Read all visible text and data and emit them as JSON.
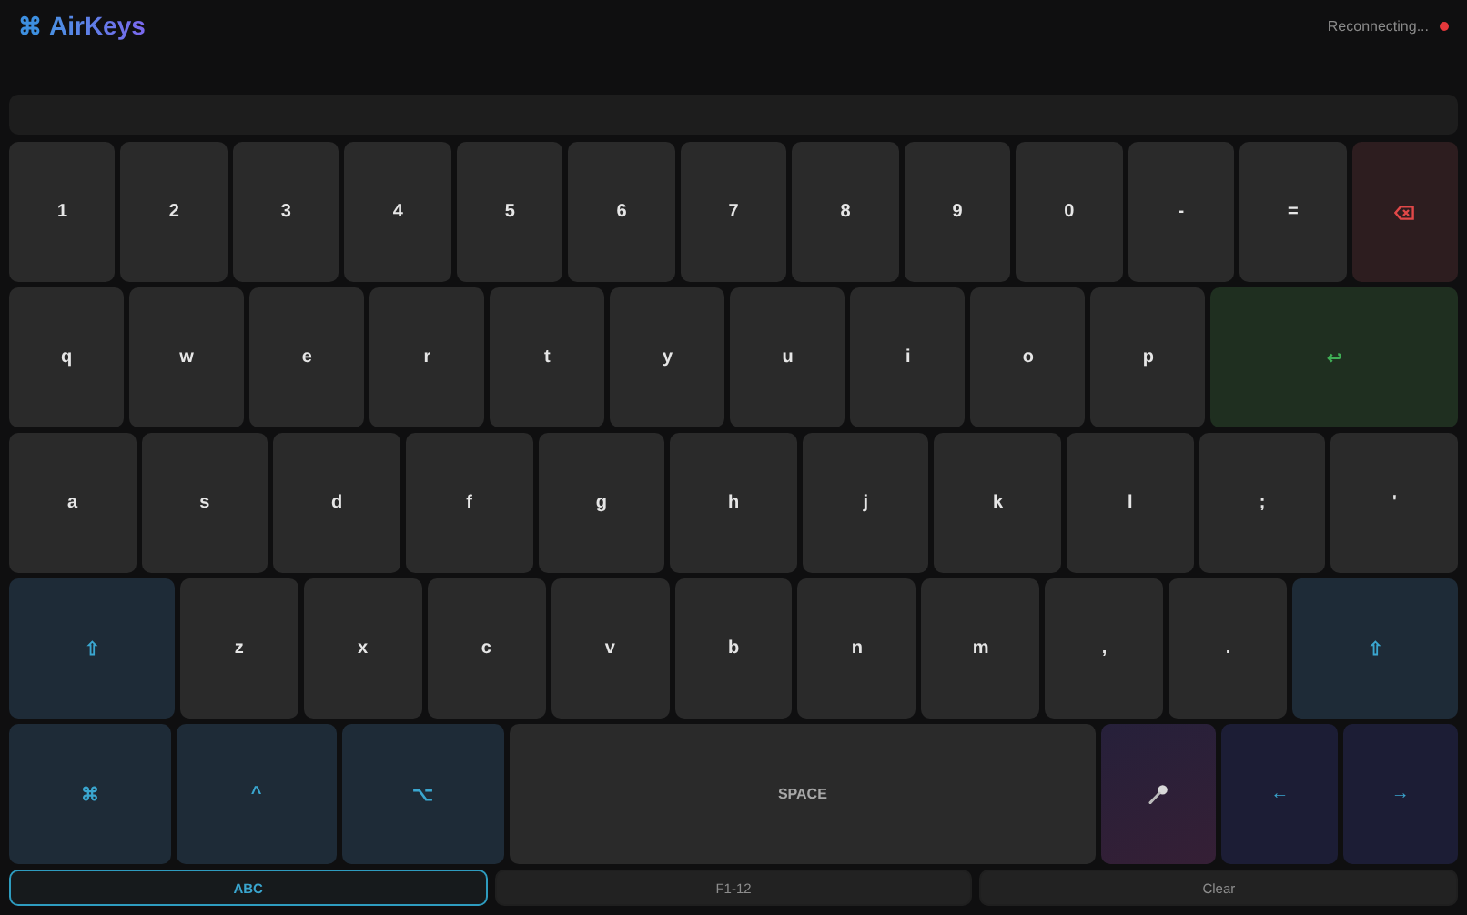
{
  "header": {
    "logo_icon": "⌘",
    "title": "AirKeys",
    "status": {
      "text": "Reconnecting...",
      "color": "#e5383b"
    }
  },
  "keyboard": {
    "rows": [
      [
        {
          "kind": "char",
          "label": "1"
        },
        {
          "kind": "char",
          "label": "2"
        },
        {
          "kind": "char",
          "label": "3"
        },
        {
          "kind": "char",
          "label": "4"
        },
        {
          "kind": "char",
          "label": "5"
        },
        {
          "kind": "char",
          "label": "6"
        },
        {
          "kind": "char",
          "label": "7"
        },
        {
          "kind": "char",
          "label": "8"
        },
        {
          "kind": "char",
          "label": "9"
        },
        {
          "kind": "char",
          "label": "0"
        },
        {
          "kind": "char",
          "label": "-"
        },
        {
          "kind": "char",
          "label": "="
        },
        {
          "kind": "backspace"
        }
      ],
      [
        {
          "kind": "char",
          "label": "q"
        },
        {
          "kind": "char",
          "label": "w"
        },
        {
          "kind": "char",
          "label": "e"
        },
        {
          "kind": "char",
          "label": "r"
        },
        {
          "kind": "char",
          "label": "t"
        },
        {
          "kind": "char",
          "label": "y"
        },
        {
          "kind": "char",
          "label": "u"
        },
        {
          "kind": "char",
          "label": "i"
        },
        {
          "kind": "char",
          "label": "o"
        },
        {
          "kind": "char",
          "label": "p"
        },
        {
          "kind": "enter",
          "label": "↩"
        }
      ],
      [
        {
          "kind": "char",
          "label": "a"
        },
        {
          "kind": "char",
          "label": "s"
        },
        {
          "kind": "char",
          "label": "d"
        },
        {
          "kind": "char",
          "label": "f"
        },
        {
          "kind": "char",
          "label": "g"
        },
        {
          "kind": "char",
          "label": "h"
        },
        {
          "kind": "char",
          "label": "j"
        },
        {
          "kind": "char",
          "label": "k"
        },
        {
          "kind": "char",
          "label": "l"
        },
        {
          "kind": "char",
          "label": ";"
        },
        {
          "kind": "char",
          "label": "'"
        }
      ],
      [
        {
          "kind": "shift",
          "label": "⇧"
        },
        {
          "kind": "char",
          "label": "z"
        },
        {
          "kind": "char",
          "label": "x"
        },
        {
          "kind": "char",
          "label": "c"
        },
        {
          "kind": "char",
          "label": "v"
        },
        {
          "kind": "char",
          "label": "b"
        },
        {
          "kind": "char",
          "label": "n"
        },
        {
          "kind": "char",
          "label": "m"
        },
        {
          "kind": "char",
          "label": ","
        },
        {
          "kind": "char",
          "label": "."
        },
        {
          "kind": "shift",
          "label": "⇧"
        }
      ],
      [
        {
          "kind": "modifier",
          "label": "⌘"
        },
        {
          "kind": "modifier",
          "label": "^"
        },
        {
          "kind": "modifier",
          "label": "⌥"
        },
        {
          "kind": "space",
          "label": "SPACE"
        },
        {
          "kind": "mic"
        },
        {
          "kind": "arrow",
          "label": "←"
        },
        {
          "kind": "arrow",
          "label": "→"
        }
      ]
    ]
  },
  "modes": [
    {
      "label": "ABC",
      "selected": true
    },
    {
      "label": "F1-12",
      "selected": false
    },
    {
      "label": "Clear",
      "selected": false
    }
  ]
}
